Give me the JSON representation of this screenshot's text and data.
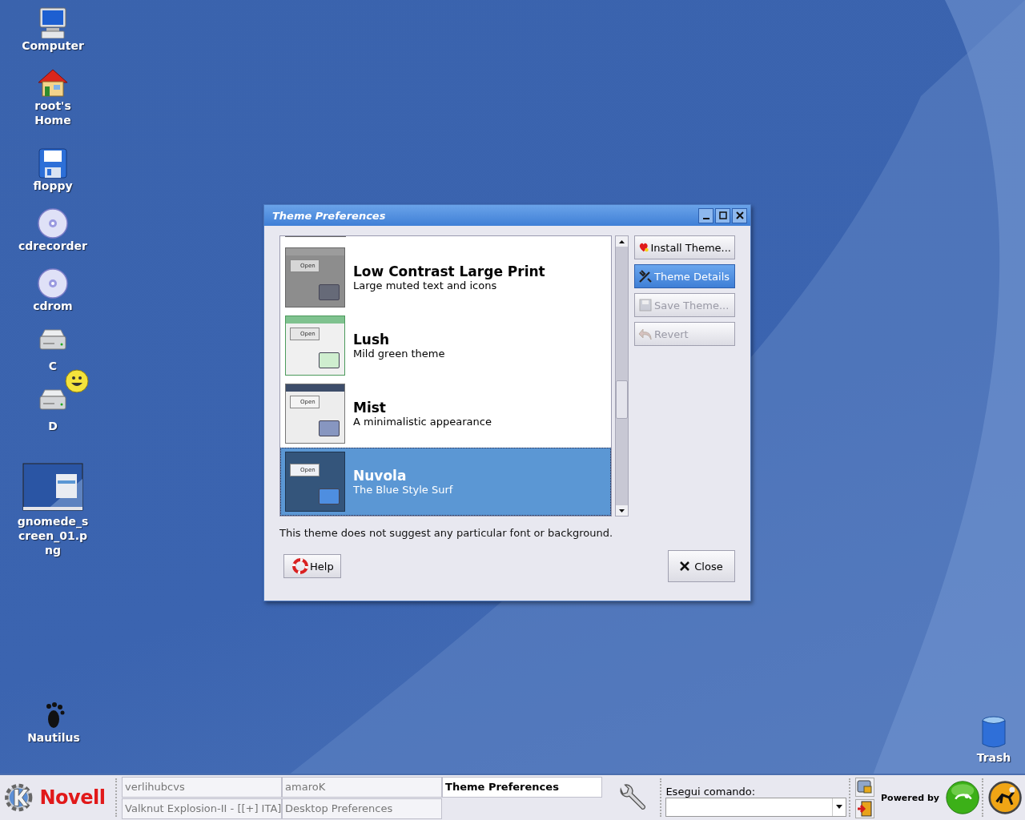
{
  "desktop_icons": [
    {
      "label": "Computer",
      "kind": "computer"
    },
    {
      "label": "root's Home",
      "kind": "home"
    },
    {
      "label": "floppy",
      "kind": "floppy"
    },
    {
      "label": "cdrecorder",
      "kind": "cd"
    },
    {
      "label": "cdrom",
      "kind": "cd"
    },
    {
      "label": "C",
      "kind": "drive"
    },
    {
      "label": "D",
      "kind": "drive"
    },
    {
      "label": "gnomede_screen_01.png",
      "kind": "image"
    }
  ],
  "nautilus_icon": {
    "label": "Nautilus"
  },
  "trash_icon": {
    "label": "Trash"
  },
  "window": {
    "title": "Theme Preferences",
    "themes": [
      {
        "name": "Low Contrast Large Print",
        "description": "Large muted text and icons",
        "kind": "gray",
        "preview_button": "Open",
        "selected": false
      },
      {
        "name": "Lush",
        "description": "Mild green theme",
        "kind": "green",
        "preview_button": "Open",
        "selected": false
      },
      {
        "name": "Mist",
        "description": "A minimalistic appearance",
        "kind": "mist",
        "preview_button": "Open",
        "selected": false
      },
      {
        "name": "Nuvola",
        "description": "The Blue Style Surf",
        "kind": "nuvola",
        "preview_button": "Open",
        "selected": true
      }
    ],
    "side_buttons": [
      {
        "label": "Install Theme...",
        "kind": "install",
        "disabled": false,
        "highlighted": false
      },
      {
        "label": "Theme Details",
        "kind": "details",
        "disabled": false,
        "highlighted": true
      },
      {
        "label": "Save Theme...",
        "kind": "save",
        "disabled": true,
        "highlighted": false
      },
      {
        "label": "Revert",
        "kind": "revert",
        "disabled": true,
        "highlighted": false
      }
    ],
    "note": "This theme does not suggest any particular font or background.",
    "help_button": "Help",
    "close_button": "Close"
  },
  "taskbar": {
    "logo": "Novell",
    "tasks": [
      {
        "label": "verlihubcvs",
        "selected": false
      },
      {
        "label": "amaroK",
        "selected": false
      },
      {
        "label": "Theme Preferences",
        "selected": true
      },
      {
        "label": "Valknut Explosion-II - [[+] ITA]",
        "selected": false
      },
      {
        "label": "Desktop Preferences",
        "selected": false
      }
    ],
    "command_label": "Esegui comando:",
    "powered_by": "Powered by"
  }
}
